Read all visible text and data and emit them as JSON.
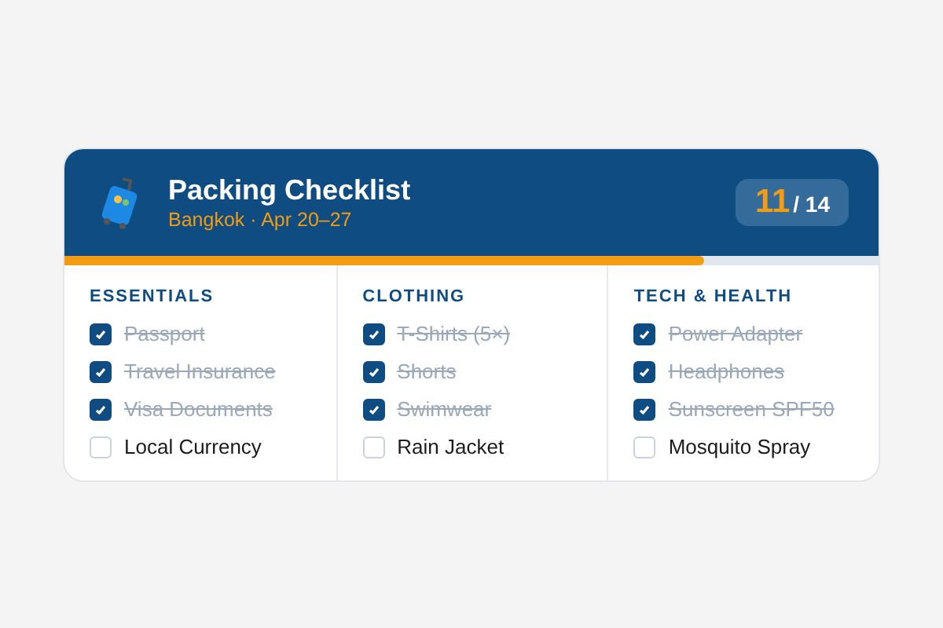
{
  "header": {
    "title": "Packing Checklist",
    "subtitle": "Bangkok · Apr 20–27",
    "packed": "11",
    "total": "/ 14"
  },
  "progress": {
    "level": 0.786
  },
  "categories": [
    {
      "title": "ESSENTIALS",
      "items": [
        {
          "label": "Passport",
          "checked": true
        },
        {
          "label": "Travel Insurance",
          "checked": true
        },
        {
          "label": "Visa Documents",
          "checked": true
        },
        {
          "label": "Local Currency",
          "checked": false
        }
      ]
    },
    {
      "title": "CLOTHING",
      "items": [
        {
          "label": "T-Shirts (5×)",
          "checked": true
        },
        {
          "label": "Shorts",
          "checked": true
        },
        {
          "label": "Swimwear",
          "checked": true
        },
        {
          "label": "Rain Jacket",
          "checked": false
        }
      ]
    },
    {
      "title": "TECH & HEALTH",
      "items": [
        {
          "label": "Power Adapter",
          "checked": true
        },
        {
          "label": "Headphones",
          "checked": true
        },
        {
          "label": "Sunscreen SPF50",
          "checked": true
        },
        {
          "label": "Mosquito Spray",
          "checked": false
        }
      ]
    }
  ]
}
